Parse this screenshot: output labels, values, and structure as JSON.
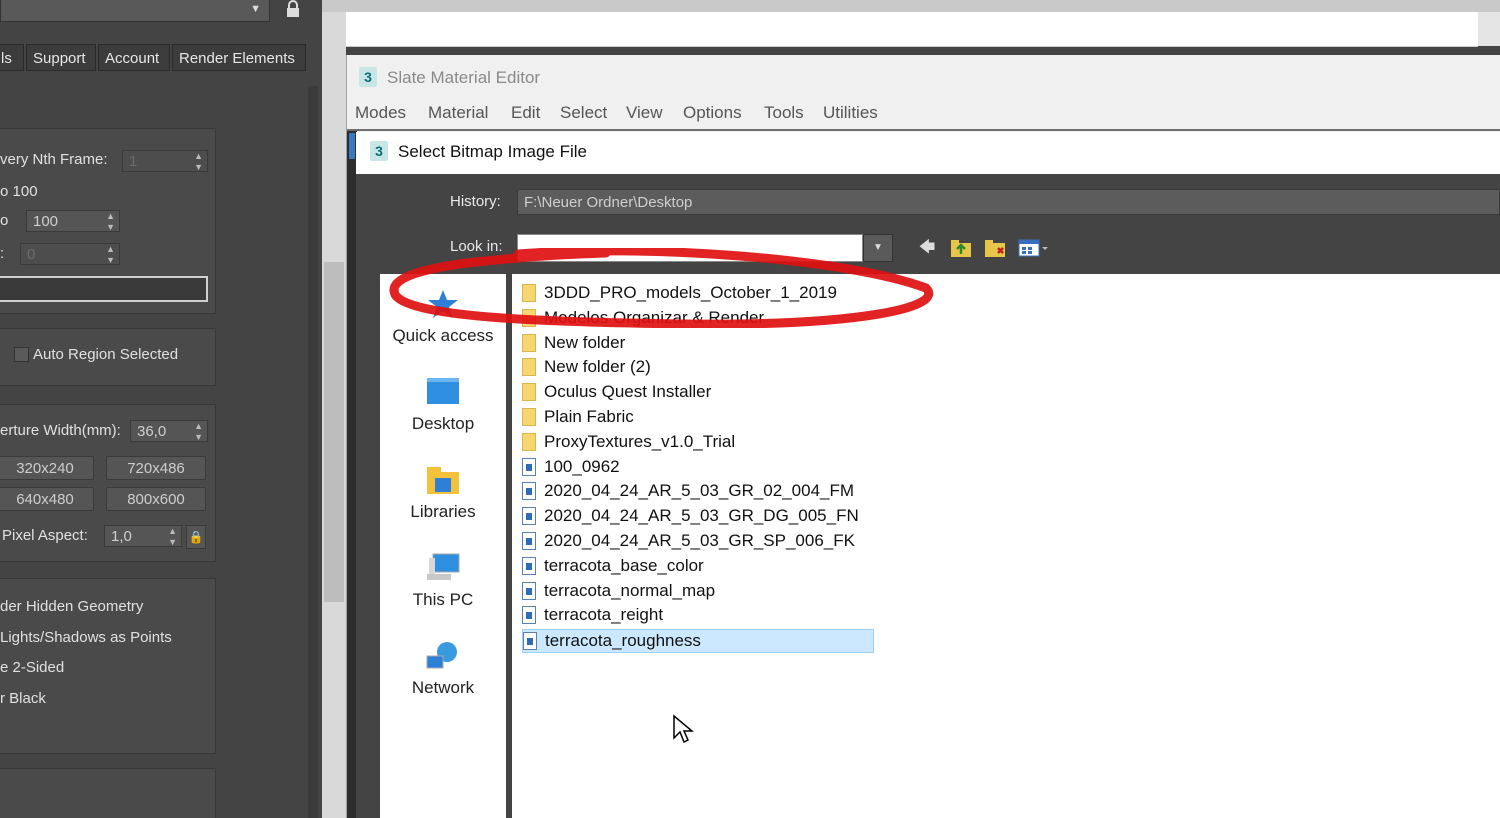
{
  "left_panel": {
    "tabs": [
      "ls",
      "Support",
      "Account",
      "Render Elements"
    ],
    "every_nth_label": "very Nth Frame:",
    "every_nth_value": "1",
    "to_label": "o 100",
    "range_label": "o",
    "range_value": "100",
    "field3_label": ":",
    "field3_value": "0",
    "auto_region_label": "Auto Region Selected",
    "aperture_label": "erture Width(mm):",
    "aperture_value": "36,0",
    "res_buttons": [
      "320x240",
      "720x486",
      "640x480",
      "800x600"
    ],
    "pixel_aspect_label": "Pixel Aspect:",
    "pixel_aspect_value": "1,0",
    "options": [
      "der Hidden Geometry",
      "Lights/Shadows as Points",
      "e 2-Sided",
      "r Black"
    ]
  },
  "sme": {
    "title": "Slate Material Editor",
    "menu": [
      "Modes",
      "Material",
      "Edit",
      "Select",
      "View",
      "Options",
      "Tools",
      "Utilities"
    ]
  },
  "dialog": {
    "title": "Select Bitmap Image File",
    "history_label": "History:",
    "history_value": "F:\\Neuer Ordner\\Desktop",
    "look_in_label": "Look in:",
    "places": [
      "Quick access",
      "Desktop",
      "Libraries",
      "This PC",
      "Network"
    ],
    "files": [
      {
        "name": "3DDD_PRO_models_October_1_2019",
        "type": "folder"
      },
      {
        "name": "Modelos Organizar & Render",
        "type": "folder"
      },
      {
        "name": "New folder",
        "type": "folder"
      },
      {
        "name": "New folder (2)",
        "type": "folder"
      },
      {
        "name": "Oculus Quest Installer",
        "type": "folder"
      },
      {
        "name": "Plain Fabric",
        "type": "folder"
      },
      {
        "name": "ProxyTextures_v1.0_Trial",
        "type": "folder"
      },
      {
        "name": "100_0962",
        "type": "image"
      },
      {
        "name": "2020_04_24_AR_5_03_GR_02_004_FM",
        "type": "image"
      },
      {
        "name": "2020_04_24_AR_5_03_GR_DG_005_FN",
        "type": "image"
      },
      {
        "name": "2020_04_24_AR_5_03_GR_SP_006_FK",
        "type": "image"
      },
      {
        "name": "terracota_base_color",
        "type": "image"
      },
      {
        "name": "terracota_normal_map",
        "type": "image"
      },
      {
        "name": "terracota_reight",
        "type": "image"
      },
      {
        "name": "terracota_roughness",
        "type": "image",
        "selected": true
      }
    ]
  },
  "colors": {
    "panel_bg": "#444444",
    "selection": "#cce8ff",
    "annotation_red": "#e01010"
  }
}
